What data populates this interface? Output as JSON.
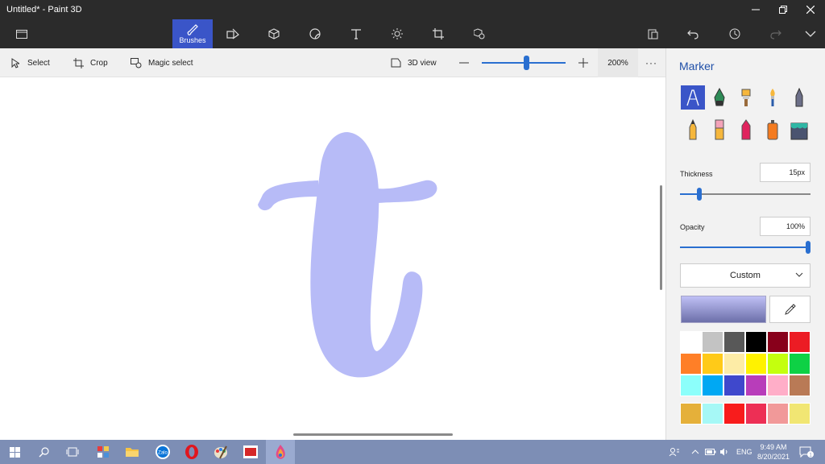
{
  "window": {
    "title": "Untitled* - Paint 3D"
  },
  "toolbar": {
    "brushes_label": "Brushes"
  },
  "subbar": {
    "select_label": "Select",
    "crop_label": "Crop",
    "magic_select_label": "Magic select",
    "view3d_label": "3D view",
    "zoom_value": "200%",
    "zoom_fraction": 0.55
  },
  "panel": {
    "title": "Marker",
    "thickness_label": "Thickness",
    "thickness_value": "15px",
    "thickness_fraction": 0.15,
    "opacity_label": "Opacity",
    "opacity_value": "100%",
    "opacity_fraction": 1.0,
    "texture_dropdown": "Custom",
    "current_color": "#b7bbf7",
    "brush_icons": [
      "marker-icon",
      "calligraphy-pen-icon",
      "oil-brush-icon",
      "watercolor-icon",
      "pixel-pen-icon",
      "pencil-icon",
      "eraser-icon",
      "crayon-icon",
      "spray-can-icon",
      "fill-bucket-icon"
    ],
    "palette": [
      "#ffffff",
      "#c3c3c3",
      "#585858",
      "#000000",
      "#88001b",
      "#ec1c24",
      "#ff7f27",
      "#ffca18",
      "#fdeca6",
      "#fff200",
      "#c4ff0e",
      "#0ed145",
      "#8cfffb",
      "#00a8f3",
      "#3f48cc",
      "#b83dba",
      "#ffaec8",
      "#b97a56"
    ],
    "custom_colors": [
      "#e5b03a",
      "#a6f8f6",
      "#f81c1c",
      "#ed2f55",
      "#f19999",
      "#f1e673"
    ]
  },
  "taskbar": {
    "ime_label": "ENG",
    "time": "9:49 AM",
    "date": "8/20/2021",
    "notification_count": "1"
  }
}
